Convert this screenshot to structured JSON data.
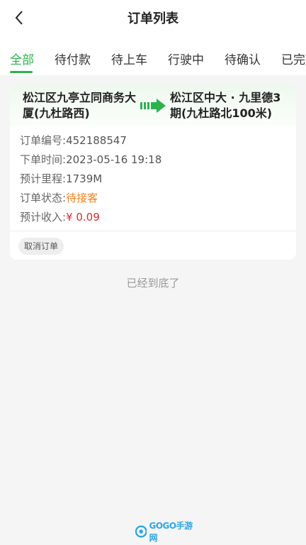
{
  "header": {
    "title": "订单列表",
    "back_icon": "chevron-left-icon"
  },
  "tabs": [
    {
      "label": "全部",
      "active": true
    },
    {
      "label": "待付款",
      "active": false
    },
    {
      "label": "待上车",
      "active": false
    },
    {
      "label": "行驶中",
      "active": false
    },
    {
      "label": "待确认",
      "active": false
    },
    {
      "label": "已完",
      "active": false
    }
  ],
  "order": {
    "from": "松江区九亭立同商务大厦(九杜路西)",
    "to": "松江区中大 · 九里德3期(九杜路北100米)",
    "arrow_icon": "arrow-right-icon",
    "fields": {
      "order_no_label": "订单编号:",
      "order_no": "452188547",
      "time_label": "下单时间:",
      "time": "2023-05-16 19:18",
      "distance_label": "预计里程:",
      "distance": "1739M",
      "status_label": "订单状态:",
      "status": "待接客",
      "income_label": "预计收入:",
      "income": "¥ 0.09"
    },
    "cancel_label": "取消订单"
  },
  "footer": {
    "end_text": "已经到底了"
  },
  "watermark": {
    "text": "GOGO手游网"
  },
  "colors": {
    "accent": "#2bb24c",
    "status": "#f5801e",
    "income": "#e8262e"
  }
}
